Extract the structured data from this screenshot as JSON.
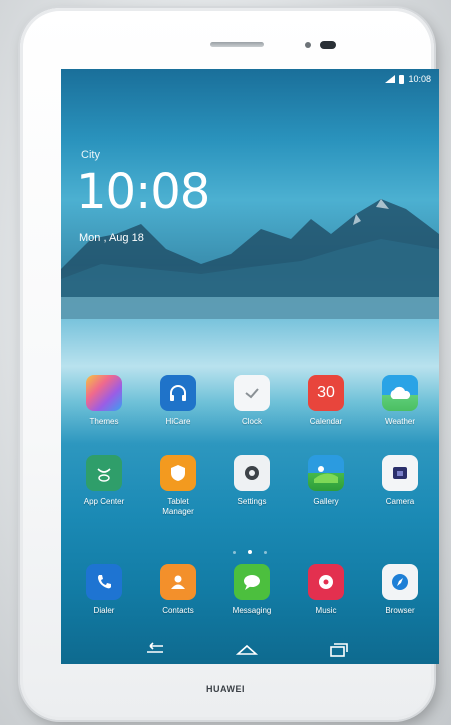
{
  "device": {
    "brand": "HUAWEI"
  },
  "status_bar": {
    "time": "10:08"
  },
  "lock": {
    "weather": "City",
    "time": "10:08",
    "date": "Mon , Aug 18"
  },
  "apps_row1": [
    {
      "label": "Themes"
    },
    {
      "label": "HiCare"
    },
    {
      "label": "Clock"
    },
    {
      "label": "Calendar",
      "icon_text": "30"
    },
    {
      "label": "Weather"
    }
  ],
  "apps_row2": [
    {
      "label": "App Center"
    },
    {
      "label": "Tablet\nManager"
    },
    {
      "label": "Settings"
    },
    {
      "label": "Gallery"
    },
    {
      "label": "Camera"
    }
  ],
  "dock": [
    {
      "label": "Dialer"
    },
    {
      "label": "Contacts"
    },
    {
      "label": "Messaging"
    },
    {
      "label": "Music"
    },
    {
      "label": "Browser"
    }
  ],
  "page_indicator": {
    "count": 3,
    "active": 2
  },
  "colors": {
    "accent": "#1e8ec0",
    "calendar": "#e8453c",
    "contacts": "#f3902b",
    "phone": "#1e74d2"
  }
}
